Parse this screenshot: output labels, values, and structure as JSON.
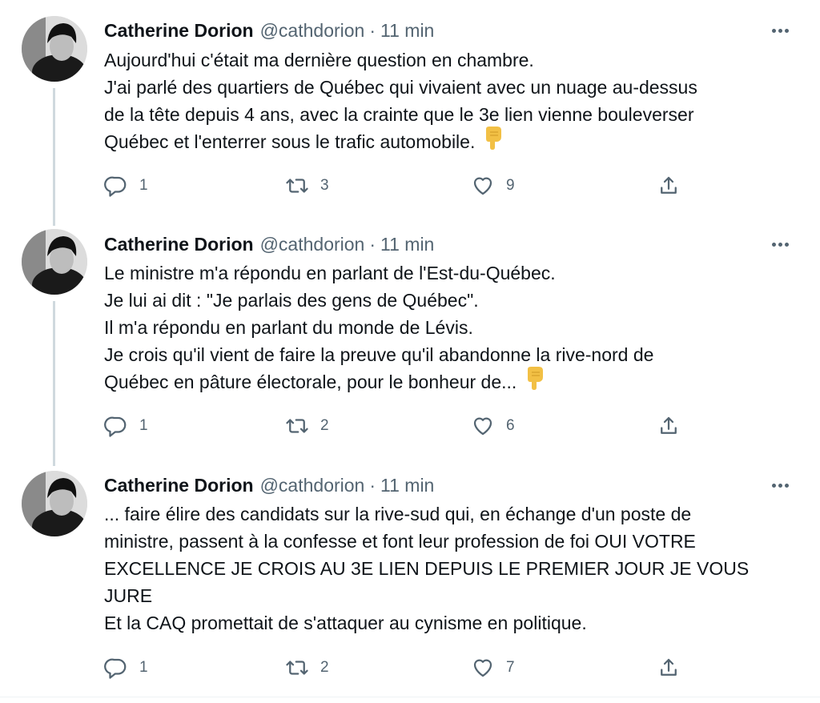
{
  "tweets": [
    {
      "author_name": "Catherine Dorion",
      "handle": "@cathdorion",
      "separator": "·",
      "time": "11 min",
      "lines": [
        "Aujourd'hui c'était ma dernière question en chambre.",
        "J'ai parlé des quartiers de Québec qui vivaient avec un nuage au-dessus",
        "de la tête depuis 4 ans, avec la crainte que le 3e lien vienne bouleverser",
        "Québec et l'enterrer sous le trafic automobile."
      ],
      "emoji": "backhand-index-pointing-down",
      "replies": "1",
      "retweets": "3",
      "likes": "9"
    },
    {
      "author_name": "Catherine Dorion",
      "handle": "@cathdorion",
      "separator": "·",
      "time": "11 min",
      "lines": [
        "Le ministre m'a répondu en parlant de l'Est-du-Québec.",
        "Je lui ai dit : \"Je parlais des gens de Québec\".",
        "Il m'a répondu en parlant du monde de Lévis.",
        "Je crois qu'il vient de faire la preuve qu'il abandonne la rive-nord de",
        "Québec en pâture électorale, pour le bonheur de..."
      ],
      "emoji": "backhand-index-pointing-down",
      "replies": "1",
      "retweets": "2",
      "likes": "6"
    },
    {
      "author_name": "Catherine Dorion",
      "handle": "@cathdorion",
      "separator": "·",
      "time": "11 min",
      "lines": [
        "... faire élire des candidats sur la rive-sud qui, en échange d'un poste de",
        "ministre, passent à la confesse et font leur profession de foi OUI VOTRE",
        "EXCELLENCE JE CROIS AU 3E LIEN DEPUIS LE PREMIER JOUR JE VOUS",
        "JURE",
        "Et la CAQ promettait de s'attaquer au cynisme en politique."
      ],
      "emoji": "",
      "replies": "1",
      "retweets": "2",
      "likes": "7"
    }
  ],
  "icons": {
    "reply": "reply-icon",
    "retweet": "retweet-icon",
    "like": "heart-icon",
    "share": "share-icon",
    "more": "more-icon"
  },
  "colors": {
    "text": "#0f1419",
    "secondary": "#536471",
    "thread_line": "#cfd9de",
    "emoji": "#f2c045"
  }
}
